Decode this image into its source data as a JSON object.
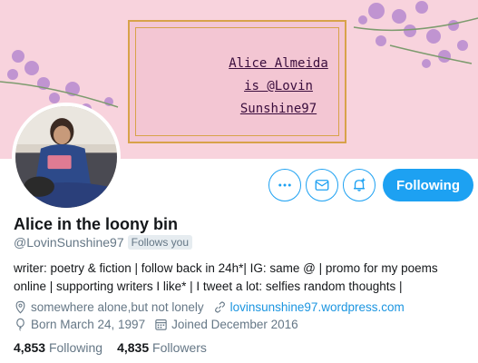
{
  "banner": {
    "line1": "Alice Almeida",
    "line2": "is @Lovin",
    "line3": "Sunshine97"
  },
  "profile": {
    "display_name": "Alice in the loony bin",
    "handle": "@LovinSunshine97",
    "follows_you": "Follows you",
    "bio_line1": "writer: poetry & fiction | follow back in 24h*| IG: same @ | promo for my poems",
    "bio_line2": "online | supporting writers I like* | I tweet a lot: selfies random thoughts |",
    "location": "somewhere alone,but not lonely",
    "website": "lovinsunshine97.wordpress.com",
    "born": "Born March 24, 1997",
    "joined": "Joined December 2016"
  },
  "actions": {
    "more_icon": "more-icon",
    "message_icon": "envelope-icon",
    "notify_icon": "bell-plus-icon",
    "follow_label": "Following"
  },
  "stats": {
    "following_count": "4,853",
    "following_label": "Following",
    "followers_count": "4,835",
    "followers_label": "Followers"
  },
  "colors": {
    "accent": "#1da1f2",
    "banner": "#f8d3dd",
    "secondary_text": "#657786"
  }
}
